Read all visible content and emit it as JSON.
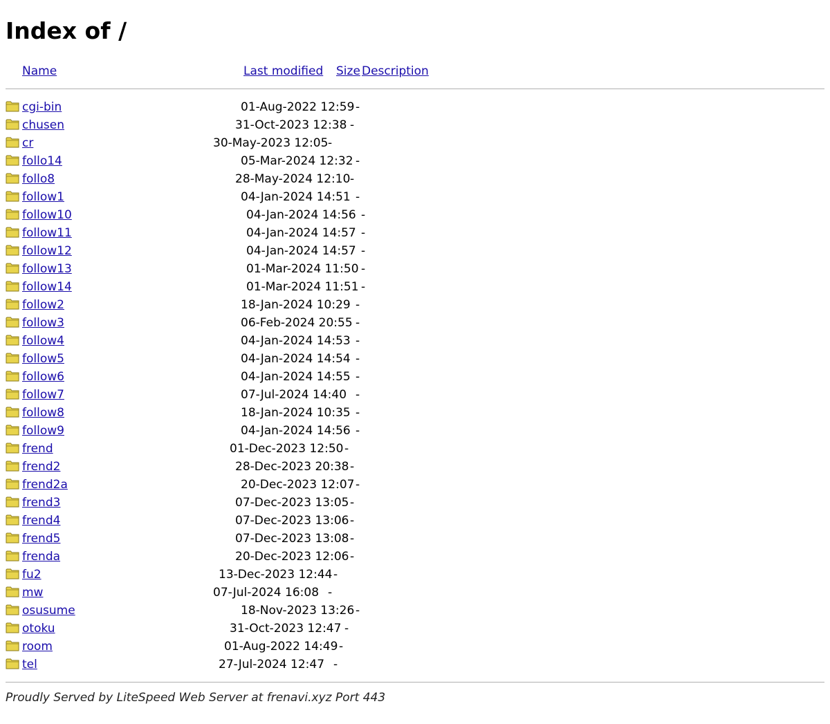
{
  "page": {
    "title": "Index of /"
  },
  "columns": {
    "name": "Name",
    "last_modified": "Last modified",
    "size": "Size",
    "description": "Description"
  },
  "rows": [
    {
      "name": "cgi-bin",
      "modified": "01-Aug-2022 12:59",
      "size": "-"
    },
    {
      "name": "chusen",
      "modified": "31-Oct-2023 12:38",
      "size": "-"
    },
    {
      "name": "cr",
      "modified": "30-May-2023 12:05",
      "size": "-"
    },
    {
      "name": "follo14",
      "modified": "05-Mar-2024 12:32",
      "size": "-"
    },
    {
      "name": "follo8",
      "modified": "28-May-2024 12:10",
      "size": "-"
    },
    {
      "name": "follow1",
      "modified": "04-Jan-2024 14:51",
      "size": "-"
    },
    {
      "name": "follow10",
      "modified": "04-Jan-2024 14:56",
      "size": "-"
    },
    {
      "name": "follow11",
      "modified": "04-Jan-2024 14:57",
      "size": "-"
    },
    {
      "name": "follow12",
      "modified": "04-Jan-2024 14:57",
      "size": "-"
    },
    {
      "name": "follow13",
      "modified": "01-Mar-2024 11:50",
      "size": "-"
    },
    {
      "name": "follow14",
      "modified": "01-Mar-2024 11:51",
      "size": "-"
    },
    {
      "name": "follow2",
      "modified": "18-Jan-2024 10:29",
      "size": "-"
    },
    {
      "name": "follow3",
      "modified": "06-Feb-2024 20:55",
      "size": "-"
    },
    {
      "name": "follow4",
      "modified": "04-Jan-2024 14:53",
      "size": "-"
    },
    {
      "name": "follow5",
      "modified": "04-Jan-2024 14:54",
      "size": "-"
    },
    {
      "name": "follow6",
      "modified": "04-Jan-2024 14:55",
      "size": "-"
    },
    {
      "name": "follow7",
      "modified": "07-Jul-2024 14:40",
      "size": "-"
    },
    {
      "name": "follow8",
      "modified": "18-Jan-2024 10:35",
      "size": "-"
    },
    {
      "name": "follow9",
      "modified": "04-Jan-2024 14:56",
      "size": "-"
    },
    {
      "name": "frend",
      "modified": "01-Dec-2023 12:50",
      "size": "-"
    },
    {
      "name": "frend2",
      "modified": "28-Dec-2023 20:38",
      "size": "-"
    },
    {
      "name": "frend2a",
      "modified": "20-Dec-2023 12:07",
      "size": "-"
    },
    {
      "name": "frend3",
      "modified": "07-Dec-2023 13:05",
      "size": "-"
    },
    {
      "name": "frend4",
      "modified": "07-Dec-2023 13:06",
      "size": "-"
    },
    {
      "name": "frend5",
      "modified": "07-Dec-2023 13:08",
      "size": "-"
    },
    {
      "name": "frenda",
      "modified": "20-Dec-2023 12:06",
      "size": "-"
    },
    {
      "name": "fu2",
      "modified": "13-Dec-2023 12:44",
      "size": "-"
    },
    {
      "name": "mw",
      "modified": "07-Jul-2024 16:08",
      "size": "-"
    },
    {
      "name": "osusume",
      "modified": "18-Nov-2023 13:26",
      "size": "-"
    },
    {
      "name": "otoku",
      "modified": "31-Oct-2023 12:47",
      "size": "-"
    },
    {
      "name": "room",
      "modified": "01-Aug-2022 14:49",
      "size": "-"
    },
    {
      "name": "tel",
      "modified": "27-Jul-2024 12:47",
      "size": "-"
    }
  ],
  "icons": {
    "folder": "folder-icon"
  },
  "colors": {
    "link": "#1a0dab",
    "folder_fill": "#e8d44d",
    "folder_stroke": "#8a7a1a"
  },
  "footer": "Proudly Served by LiteSpeed Web Server at frenavi.xyz Port 443"
}
